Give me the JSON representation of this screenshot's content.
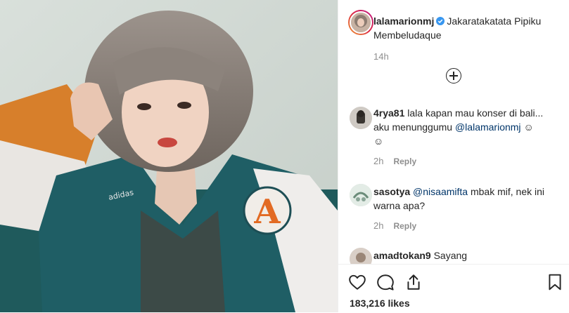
{
  "post": {
    "author": "lalamarionmj",
    "caption": "Jakaratakatata Pipiku Membeludaque",
    "time": "14h",
    "likes": "183,216 likes",
    "photo_text": {
      "brand": "adidas",
      "patch": "A"
    }
  },
  "comments": [
    {
      "username": "4rya81",
      "text": "lala kapan mau konser di bali... aku menunggumu",
      "mention": "@lalamarionmj",
      "trailing": "☺",
      "trailing2": "☺",
      "time": "2h",
      "reply": "Reply"
    },
    {
      "username": "sasotya",
      "mention": "@nisaamifta",
      "text": "mbak mif, nek ini warna apa?",
      "time": "2h",
      "reply": "Reply"
    },
    {
      "username": "amadtokan9",
      "text": "Sayang"
    }
  ],
  "icons": {
    "like": "heart-icon",
    "comment": "comment-icon",
    "share": "share-icon",
    "save": "bookmark-icon",
    "load_more": "plus-circle-icon",
    "verified": "verified-badge-icon"
  },
  "colors": {
    "text": "#262626",
    "muted": "#8e8e8e",
    "mention": "#003569",
    "verified": "#3897f0"
  }
}
